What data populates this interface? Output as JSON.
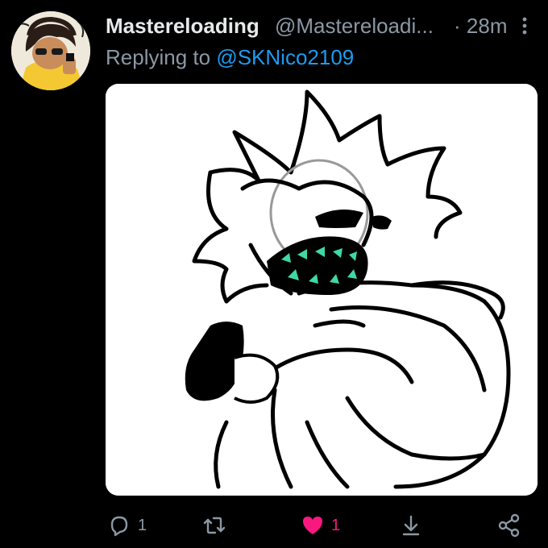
{
  "tweet": {
    "author": {
      "display_name": "Mastereloading",
      "handle": "@Mastereloadi...",
      "avatar_icon": "user-avatar-drawing"
    },
    "separator": "·",
    "timestamp": "28m",
    "reply": {
      "prefix": "Replying to ",
      "mention": "@SKNico2109"
    },
    "media": {
      "kind": "drawing"
    },
    "actions": {
      "reply": {
        "icon": "reply-icon",
        "count": "1"
      },
      "retweet": {
        "icon": "retweet-icon",
        "count": ""
      },
      "like": {
        "icon": "heart-filled-icon",
        "count": "1",
        "color": "#f91880"
      },
      "download": {
        "icon": "download-icon"
      },
      "share": {
        "icon": "share-icon"
      }
    }
  },
  "colors": {
    "background": "#000000",
    "text_primary": "#e7e9ea",
    "text_secondary": "#8b98a5",
    "link": "#1d9bf0",
    "like": "#f91880"
  }
}
